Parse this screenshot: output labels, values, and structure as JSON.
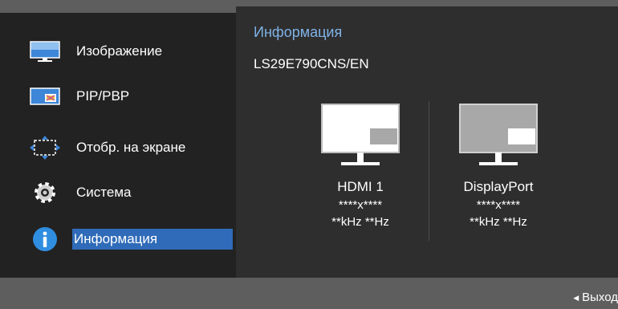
{
  "menu": {
    "items": [
      {
        "label": "Изображение",
        "icon": "picture-icon"
      },
      {
        "label": "PIP/PBP",
        "icon": "pip-pbp-icon"
      },
      {
        "label": "Отобр. на экране",
        "icon": "onscreen-display-icon"
      },
      {
        "label": "Система",
        "icon": "gear-icon"
      },
      {
        "label": "Информация",
        "icon": "info-icon",
        "selected": true
      }
    ]
  },
  "panel": {
    "title": "Информация",
    "model": "LS29E790CNS/EN",
    "ports": [
      {
        "name": "HDMI 1",
        "resolution": "****x****",
        "frequency": "**kHz **Hz"
      },
      {
        "name": "DisplayPort",
        "resolution": "****x****",
        "frequency": "**kHz **Hz"
      }
    ]
  },
  "footer": {
    "exit_label": "Выход"
  },
  "colors": {
    "accent": "#2f6bb8",
    "title_blue": "#7fb2e6",
    "info_icon": "#2f8ee0"
  }
}
